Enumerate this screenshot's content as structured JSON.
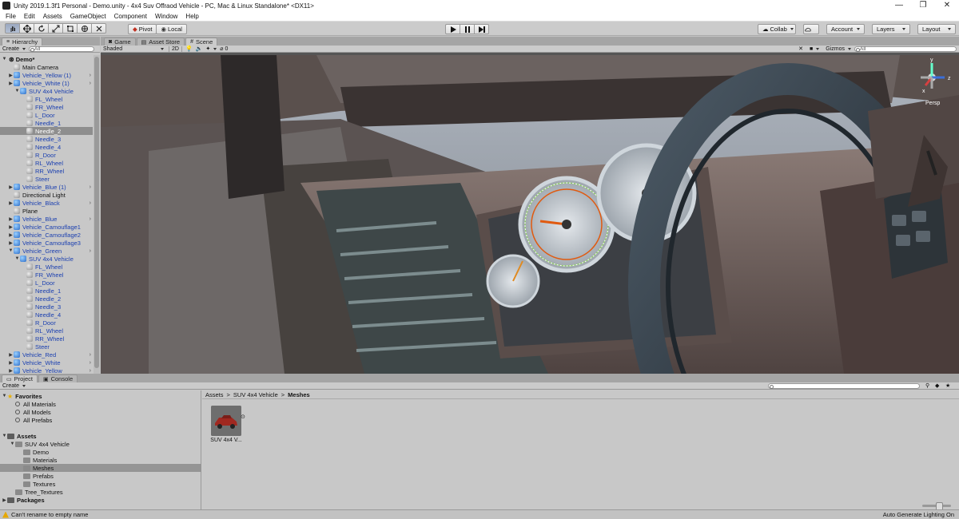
{
  "window": {
    "title": "Unity 2019.1.3f1 Personal - Demo.unity - 4x4 Suv Offraod Vehicle - PC, Mac & Linux Standalone* <DX11>",
    "buttons": [
      "—",
      "❐",
      "✕"
    ]
  },
  "menu": [
    "File",
    "Edit",
    "Assets",
    "GameObject",
    "Component",
    "Window",
    "Help"
  ],
  "toolbar": {
    "tools": [
      "hand-icon",
      "move-icon",
      "rotate-icon",
      "scale-icon",
      "rect-icon",
      "transform-icon",
      "custom-tool-icon"
    ],
    "pivot_label": "Pivot",
    "local_label": "Local",
    "collab_label": "Collab",
    "account_label": "Account",
    "layers_label": "Layers",
    "layout_label": "Layout"
  },
  "hierarchy": {
    "tab": "Hierarchy",
    "create_label": "Create",
    "search_placeholder": "All",
    "scene_name": "Demo*",
    "items": [
      {
        "label": "Main Camera",
        "indent": 1,
        "icon": "gray",
        "prefab": false,
        "arrow": "",
        "more": false
      },
      {
        "label": "Vehicle_Yellow (1)",
        "indent": 1,
        "icon": "blue",
        "prefab": true,
        "arrow": "▶",
        "more": true
      },
      {
        "label": "Vehicle_White (1)",
        "indent": 1,
        "icon": "blue",
        "prefab": true,
        "arrow": "▶",
        "more": true
      },
      {
        "label": "SUV 4x4 Vehicle",
        "indent": 2,
        "icon": "blue",
        "prefab": true,
        "arrow": "▼",
        "more": false
      },
      {
        "label": "FL_Wheel",
        "indent": 3,
        "icon": "gray",
        "prefab": true,
        "arrow": "",
        "more": false
      },
      {
        "label": "FR_Wheel",
        "indent": 3,
        "icon": "gray",
        "prefab": true,
        "arrow": "",
        "more": false
      },
      {
        "label": "L_Door",
        "indent": 3,
        "icon": "gray",
        "prefab": true,
        "arrow": "",
        "more": false
      },
      {
        "label": "Needle_1",
        "indent": 3,
        "icon": "gray",
        "prefab": true,
        "arrow": "",
        "more": false
      },
      {
        "label": "Needle_2",
        "indent": 3,
        "icon": "gray",
        "prefab": true,
        "arrow": "",
        "more": false,
        "selected": true
      },
      {
        "label": "Needle_3",
        "indent": 3,
        "icon": "gray",
        "prefab": true,
        "arrow": "",
        "more": false
      },
      {
        "label": "Needle_4",
        "indent": 3,
        "icon": "gray",
        "prefab": true,
        "arrow": "",
        "more": false
      },
      {
        "label": "R_Door",
        "indent": 3,
        "icon": "gray",
        "prefab": true,
        "arrow": "",
        "more": false
      },
      {
        "label": "RL_Wheel",
        "indent": 3,
        "icon": "gray",
        "prefab": true,
        "arrow": "",
        "more": false
      },
      {
        "label": "RR_Wheel",
        "indent": 3,
        "icon": "gray",
        "prefab": true,
        "arrow": "",
        "more": false
      },
      {
        "label": "Steer",
        "indent": 3,
        "icon": "gray",
        "prefab": true,
        "arrow": "",
        "more": false
      },
      {
        "label": "Vehicle_Blue (1)",
        "indent": 1,
        "icon": "blue",
        "prefab": true,
        "arrow": "▶",
        "more": true
      },
      {
        "label": "Directional Light",
        "indent": 1,
        "icon": "gray",
        "prefab": false,
        "arrow": "",
        "more": false
      },
      {
        "label": "Vehicle_Black",
        "indent": 1,
        "icon": "blue",
        "prefab": true,
        "arrow": "▶",
        "more": true
      },
      {
        "label": "Plane",
        "indent": 1,
        "icon": "gray",
        "prefab": false,
        "arrow": "",
        "more": false
      },
      {
        "label": "Vehicle_Blue",
        "indent": 1,
        "icon": "blue",
        "prefab": true,
        "arrow": "▶",
        "more": true
      },
      {
        "label": "Vehicle_Camouflage1",
        "indent": 1,
        "icon": "blue",
        "prefab": true,
        "arrow": "▶",
        "more": false
      },
      {
        "label": "Vehicle_Camouflage2",
        "indent": 1,
        "icon": "blue",
        "prefab": true,
        "arrow": "▶",
        "more": false
      },
      {
        "label": "Vehicle_Camouflage3",
        "indent": 1,
        "icon": "blue",
        "prefab": true,
        "arrow": "▶",
        "more": false
      },
      {
        "label": "Vehicle_Green",
        "indent": 1,
        "icon": "blue",
        "prefab": true,
        "arrow": "▼",
        "more": true
      },
      {
        "label": "SUV 4x4 Vehicle",
        "indent": 2,
        "icon": "blue",
        "prefab": true,
        "arrow": "▼",
        "more": false
      },
      {
        "label": "FL_Wheel",
        "indent": 3,
        "icon": "gray",
        "prefab": true,
        "arrow": "",
        "more": false
      },
      {
        "label": "FR_Wheel",
        "indent": 3,
        "icon": "gray",
        "prefab": true,
        "arrow": "",
        "more": false
      },
      {
        "label": "L_Door",
        "indent": 3,
        "icon": "gray",
        "prefab": true,
        "arrow": "",
        "more": false
      },
      {
        "label": "Needle_1",
        "indent": 3,
        "icon": "gray",
        "prefab": true,
        "arrow": "",
        "more": false
      },
      {
        "label": "Needle_2",
        "indent": 3,
        "icon": "gray",
        "prefab": true,
        "arrow": "",
        "more": false
      },
      {
        "label": "Needle_3",
        "indent": 3,
        "icon": "gray",
        "prefab": true,
        "arrow": "",
        "more": false
      },
      {
        "label": "Needle_4",
        "indent": 3,
        "icon": "gray",
        "prefab": true,
        "arrow": "",
        "more": false
      },
      {
        "label": "R_Door",
        "indent": 3,
        "icon": "gray",
        "prefab": true,
        "arrow": "",
        "more": false
      },
      {
        "label": "RL_Wheel",
        "indent": 3,
        "icon": "gray",
        "prefab": true,
        "arrow": "",
        "more": false
      },
      {
        "label": "RR_Wheel",
        "indent": 3,
        "icon": "gray",
        "prefab": true,
        "arrow": "",
        "more": false
      },
      {
        "label": "Steer",
        "indent": 3,
        "icon": "gray",
        "prefab": true,
        "arrow": "",
        "more": false
      },
      {
        "label": "Vehicle_Red",
        "indent": 1,
        "icon": "blue",
        "prefab": true,
        "arrow": "▶",
        "more": true
      },
      {
        "label": "Vehicle_White",
        "indent": 1,
        "icon": "blue",
        "prefab": true,
        "arrow": "▶",
        "more": true
      },
      {
        "label": "Vehicle_Yellow",
        "indent": 1,
        "icon": "blue",
        "prefab": true,
        "arrow": "▶",
        "more": true
      }
    ]
  },
  "scene_tabs": [
    "Game",
    "Asset Store",
    "Scene"
  ],
  "scene_bar": {
    "shading": "Shaded",
    "mode_2d": "2D",
    "hidden_count": "0",
    "gizmos_label": "Gizmos",
    "search_placeholder": "All",
    "persp_label": "Persp",
    "axis_y": "y",
    "axis_x": "x",
    "axis_z": "z"
  },
  "bottom_tabs": [
    "Project",
    "Console"
  ],
  "project": {
    "create_label": "Create",
    "favorites_label": "Favorites",
    "favorites": [
      "All Materials",
      "All Models",
      "All Prefabs"
    ],
    "assets_label": "Assets",
    "tree": [
      {
        "label": "SUV 4x4 Vehicle",
        "indent": 1,
        "arrow": "▼"
      },
      {
        "label": "Demo",
        "indent": 2,
        "arrow": ""
      },
      {
        "label": "Materials",
        "indent": 2,
        "arrow": ""
      },
      {
        "label": "Meshes",
        "indent": 2,
        "arrow": "",
        "selected": true
      },
      {
        "label": "Prefabs",
        "indent": 2,
        "arrow": ""
      },
      {
        "label": "Textures",
        "indent": 2,
        "arrow": ""
      },
      {
        "label": "Tree_Textures",
        "indent": 1,
        "arrow": ""
      }
    ],
    "packages_label": "Packages",
    "breadcrumb": [
      "Assets",
      ">",
      "SUV 4x4 Vehicle",
      ">",
      "Meshes"
    ],
    "asset_name": "SUV 4x4 V..."
  },
  "status": {
    "message": "Can't rename to empty name",
    "right": "Auto Generate Lighting On"
  }
}
